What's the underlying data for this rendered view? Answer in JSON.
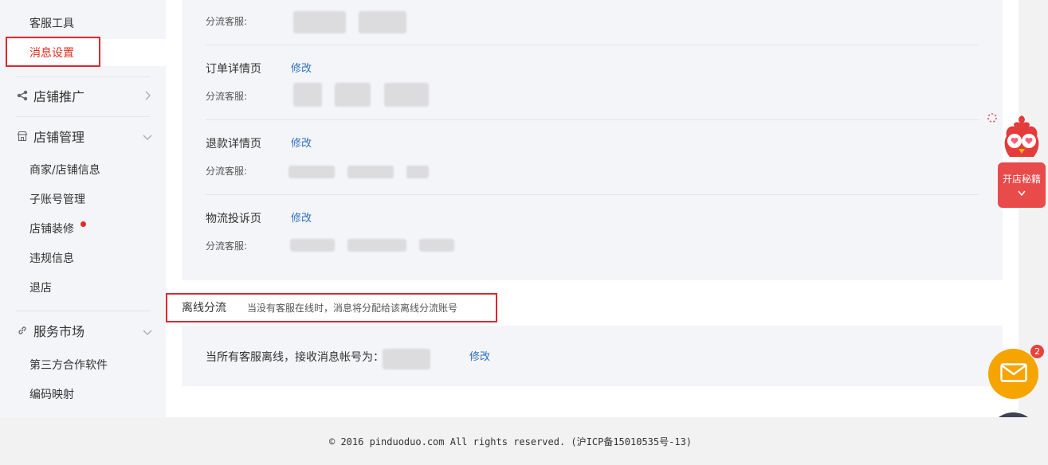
{
  "sidebar": {
    "customer_tools": "客服工具",
    "message_settings": "消息设置",
    "store_promotion": {
      "label": "店铺推广",
      "icon": "share-icon"
    },
    "store_management": {
      "label": "店铺管理",
      "icon": "store-icon",
      "items": [
        "商家/店铺信息",
        "子账号管理",
        "店铺装修",
        "违规信息",
        "退店"
      ]
    },
    "service_market": {
      "label": "服务市场",
      "icon": "link-icon",
      "items": [
        "第三方合作软件",
        "编码映射"
      ]
    }
  },
  "main": {
    "rows": [
      {
        "label": "分流客服:"
      },
      {
        "title": "订单详情页",
        "edit": "修改",
        "label": "分流客服:"
      },
      {
        "title": "退款详情页",
        "edit": "修改",
        "label": "分流客服:"
      },
      {
        "title": "物流投诉页",
        "edit": "修改",
        "label": "分流客服:"
      }
    ],
    "offline": {
      "title": "离线分流",
      "desc": "当没有客服在线时，消息将分配给该离线分流账号",
      "label": "当所有客服离线，接收消息帐号为：",
      "edit": "修改"
    }
  },
  "footer": {
    "text": "© 2016 pinduoduo.com All rights reserved. (沪ICP备15010535号-13)"
  },
  "widgets": {
    "mascot_label": "开店秘籍",
    "message_badge": "2"
  },
  "colors": {
    "accent_red": "#e02e24",
    "link_blue": "#2b6fc2",
    "mail_orange": "#f5a400",
    "feedback_dark": "#3d4454"
  }
}
